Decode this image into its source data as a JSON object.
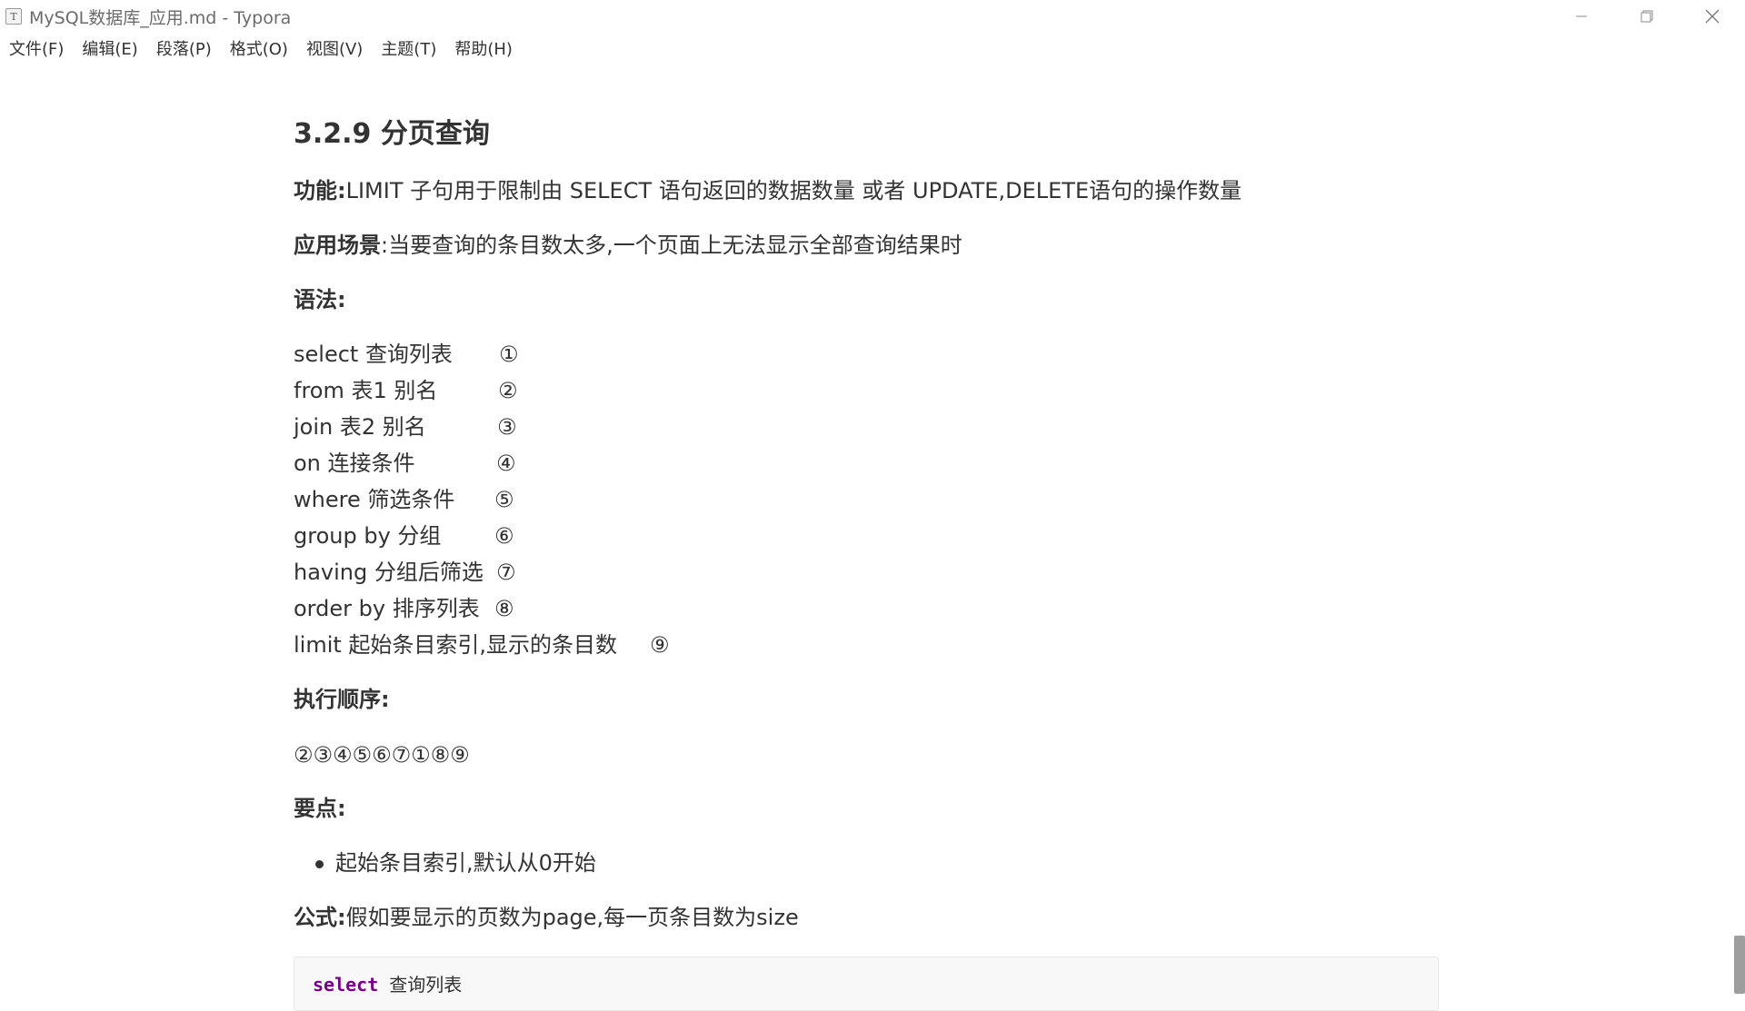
{
  "window": {
    "title": "MySQL数据库_应用.md - Typora",
    "app_icon_letter": "T"
  },
  "menu": [
    "文件(F)",
    "编辑(E)",
    "段落(P)",
    "格式(O)",
    "视图(V)",
    "主题(T)",
    "帮助(H)"
  ],
  "doc": {
    "heading": "3.2.9 分页查询",
    "function_label": "功能:",
    "function_text": "LIMIT 子句用于限制由 SELECT 语句返回的数据数量 或者 UPDATE,DELETE语句的操作数量",
    "scene_label": "应用场景",
    "scene_text": ":当要查询的条目数太多,一个页面上无法显示全部查询结果时",
    "syntax_label": "语法:",
    "syntax_lines": [
      {
        "text": "select 查询列表",
        "num": "①"
      },
      {
        "text": "from 表1 别名",
        "num": "②"
      },
      {
        "text": "join 表2 别名",
        "num": "③"
      },
      {
        "text": "on 连接条件",
        "num": "④"
      },
      {
        "text": "where 筛选条件",
        "num": "⑤"
      },
      {
        "text": "group by 分组",
        "num": "⑥"
      },
      {
        "text": "having 分组后筛选",
        "num": "⑦"
      },
      {
        "text": "order by 排序列表",
        "num": "⑧"
      },
      {
        "text": "limit 起始条目索引,显示的条目数",
        "num": "⑨"
      }
    ],
    "order_label": "执行顺序:",
    "order_text": "②③④⑤⑥⑦①⑧⑨",
    "points_label": "要点:",
    "bullet_text": "起始条目索引,默认从0开始",
    "formula_label": "公式:",
    "formula_text": "假如要显示的页数为page,每一页条目数为size",
    "code_keyword": "select",
    "code_rest": " 查询列表"
  },
  "colors": {
    "text": "#333333",
    "title_gray": "#6b6b6b",
    "code_keyword": "#770088",
    "scroll_thumb": "#9e9e9e"
  }
}
